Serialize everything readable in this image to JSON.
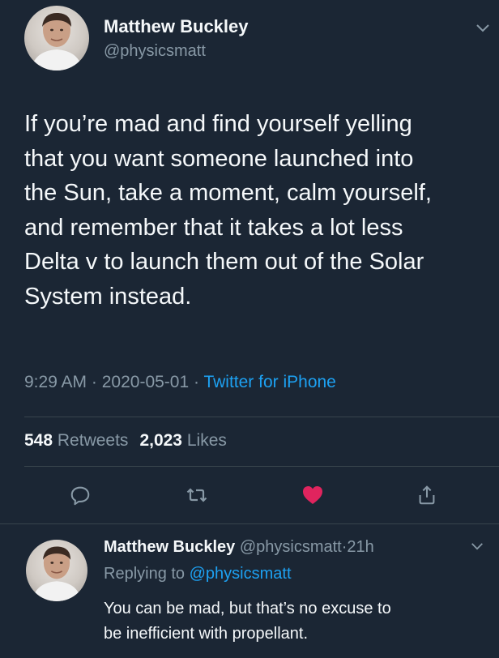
{
  "tweet": {
    "author_name": "Matthew Buckley",
    "author_handle": "@physicsmatt",
    "text_lines": [
      "If you’re mad and find yourself yelling",
      "that you want someone launched into",
      "the Sun, take a moment, calm yourself,",
      "and remember that it takes a lot less",
      "Delta v to launch them out of the Solar",
      "System instead."
    ],
    "time": "9:29 AM",
    "date": "2020-05-01",
    "separator": " · ",
    "source": "Twitter for iPhone",
    "retweets_count": "548",
    "retweets_label": "Retweets",
    "likes_count": "2,023",
    "likes_label": "Likes",
    "liked": true
  },
  "actions": [
    {
      "icon": "comment-icon"
    },
    {
      "icon": "retweet-icon"
    },
    {
      "icon": "heart-icon"
    },
    {
      "icon": "share-icon"
    }
  ],
  "reply": {
    "author_name": "Matthew Buckley",
    "author_handle": "@physicsmatt",
    "age": "21h",
    "replying_prefix": "Replying to",
    "replying_to": "@physicsmatt",
    "text_lines": [
      "You can be mad, but that’s no excuse to",
      "be inefficient with propellant."
    ]
  },
  "colors": {
    "background": "#1b2634",
    "text": "#f5f8fa",
    "secondary": "#8899a6",
    "link": "#1da1f2",
    "like": "#e0245e",
    "divider": "#38444d"
  }
}
